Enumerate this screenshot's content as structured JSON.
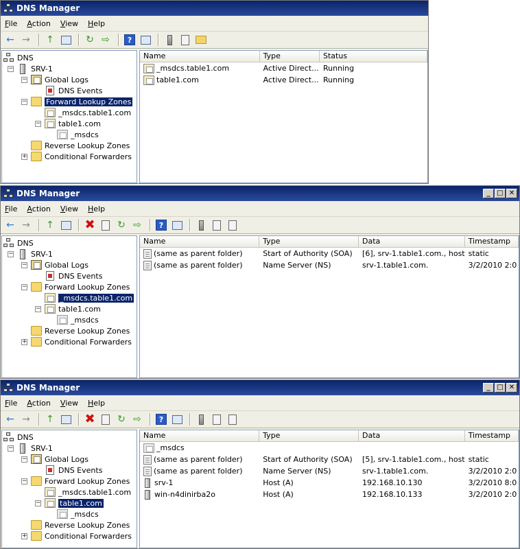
{
  "app_title": "DNS Manager",
  "menu": [
    {
      "key": "F",
      "rest": "ile"
    },
    {
      "key": "A",
      "rest": "ction"
    },
    {
      "key": "V",
      "rest": "iew"
    },
    {
      "key": "H",
      "rest": "elp"
    }
  ],
  "window_buttons": {
    "minimize": "_",
    "maximize": "□",
    "close": "✕"
  },
  "toolbar_icons": {
    "back": "←",
    "forward": "→",
    "up": "↑",
    "del": "✖",
    "refresh": "↻",
    "export": "⇨",
    "help": "?"
  },
  "tree": {
    "root": "DNS",
    "server": "SRV-1",
    "global_logs": "Global Logs",
    "dns_events": "DNS Events",
    "forward_zones": "Forward Lookup Zones",
    "msdcs_zone": "_msdcs.table1.com",
    "table1_zone": "table1.com",
    "msdcs_sub": "_msdcs",
    "reverse_zones": "Reverse Lookup Zones",
    "conditional": "Conditional Forwarders",
    "exp_minus": "−",
    "exp_plus": "+"
  },
  "windows": [
    {
      "columns": [
        "Name",
        "Type",
        "Status"
      ],
      "rows": [
        [
          "_msdcs.table1.com",
          "Active Direct...",
          "Running"
        ],
        [
          "table1.com",
          "Active Direct...",
          "Running"
        ]
      ]
    },
    {
      "columns": [
        "Name",
        "Type",
        "Data",
        "Timestamp"
      ],
      "rows": [
        [
          "(same as parent folder)",
          "Start of Authority (SOA)",
          "[6], srv-1.table1.com., host...",
          "static"
        ],
        [
          "(same as parent folder)",
          "Name Server (NS)",
          "srv-1.table1.com.",
          "3/2/2010 2:0"
        ]
      ]
    },
    {
      "columns": [
        "Name",
        "Type",
        "Data",
        "Timestamp"
      ],
      "rows": [
        [
          "_msdcs",
          "",
          "",
          ""
        ],
        [
          "(same as parent folder)",
          "Start of Authority (SOA)",
          "[5], srv-1.table1.com., host...",
          "static"
        ],
        [
          "(same as parent folder)",
          "Name Server (NS)",
          "srv-1.table1.com.",
          "3/2/2010 2:0"
        ],
        [
          "srv-1",
          "Host (A)",
          "192.168.10.130",
          "3/2/2010 8:0"
        ],
        [
          "win-n4dinirba2o",
          "Host (A)",
          "192.168.10.133",
          "3/2/2010 2:0"
        ]
      ]
    }
  ]
}
